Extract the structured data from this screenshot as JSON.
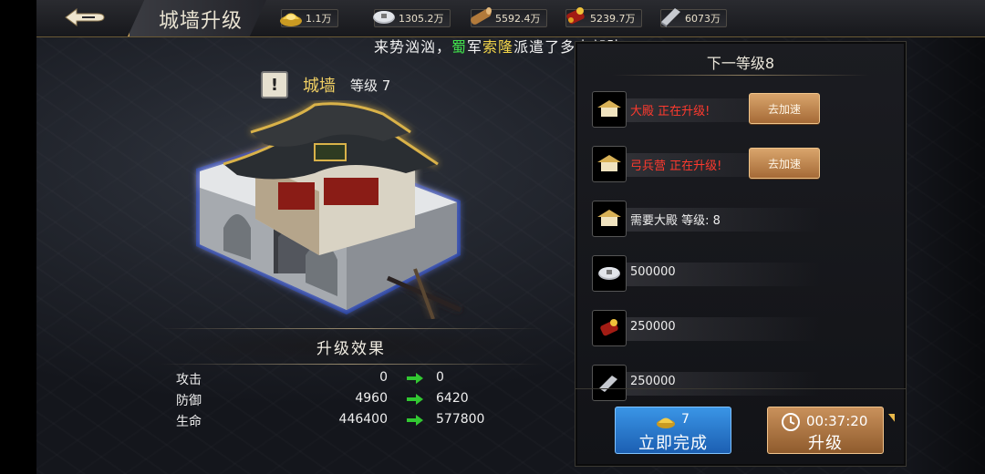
{
  "header": {
    "title": "城墙升级",
    "resources": [
      {
        "name": "gold-ingot-icon",
        "value": "1.1万"
      },
      {
        "name": "silver-coin-icon",
        "value": "1305.2万"
      },
      {
        "name": "wood-log-icon",
        "value": "5592.4万"
      },
      {
        "name": "food-icon",
        "value": "5239.7万"
      },
      {
        "name": "iron-icon",
        "value": "6073万"
      }
    ]
  },
  "banner": {
    "part1": "来势汹汹，",
    "part2": "蜀",
    "part3": "军",
    "part4": "索隆",
    "part5": "派遣了多支部队"
  },
  "building": {
    "name": "城墙",
    "level_label": "等级 7"
  },
  "effects": {
    "title": "升级效果",
    "rows": [
      {
        "label": "攻击",
        "current": "0",
        "next": "0"
      },
      {
        "label": "防御",
        "current": "4960",
        "next": "6420"
      },
      {
        "label": "生命",
        "current": "446400",
        "next": "577800"
      }
    ]
  },
  "panel": {
    "title": "下一等级8",
    "requirements": [
      {
        "text": "大殿 正在升级!",
        "status": "upgrading",
        "button": "去加速"
      },
      {
        "text": "弓兵营 正在升级!",
        "status": "upgrading",
        "button": "去加速"
      },
      {
        "text": "需要大殿 等级: 8",
        "status": "normal"
      },
      {
        "text": "500000",
        "status": "normal",
        "icon": "silver-coin-icon"
      },
      {
        "text": "250000",
        "status": "normal",
        "icon": "food-icon"
      },
      {
        "text": "250000",
        "status": "normal",
        "icon": "iron-icon"
      }
    ],
    "complete_cost": "7",
    "complete_label": "立即完成",
    "timer": "00:37:20",
    "upgrade_label": "升级"
  }
}
